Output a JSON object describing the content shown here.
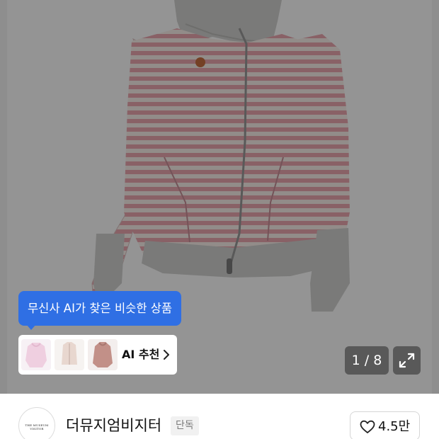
{
  "gallery": {
    "image_alt": "pink and cream striped zip-up hoodie with grey hood and cuffs",
    "counter": "1 / 8",
    "expand_icon": "expand-arrows-icon",
    "colors": {
      "stripe_pink": "#eca7b0",
      "stripe_cream": "#fbf1ec",
      "rib_grey": "#d3d3d1",
      "backdrop": "#ffffff"
    }
  },
  "ai_recommendation": {
    "tooltip": "무신사 AI가 찾은 비슷한 상품",
    "label": "AI 추천",
    "chevron_icon": "chevron-right-icon",
    "accent": "#2f6fe4",
    "thumbnails": [
      {
        "name": "pink hoodie",
        "color": "#efcfe0"
      },
      {
        "name": "beige zip hoodie",
        "color": "#e8d7cf"
      },
      {
        "name": "mauve hoodie",
        "color": "#c29088"
      }
    ]
  },
  "seller": {
    "logo_text": "THE MUSEUM VISITOR",
    "brand_name": "더뮤지엄비지터",
    "badge": "단독",
    "likes": "4.5만",
    "heart_icon": "heart-outline-icon"
  }
}
